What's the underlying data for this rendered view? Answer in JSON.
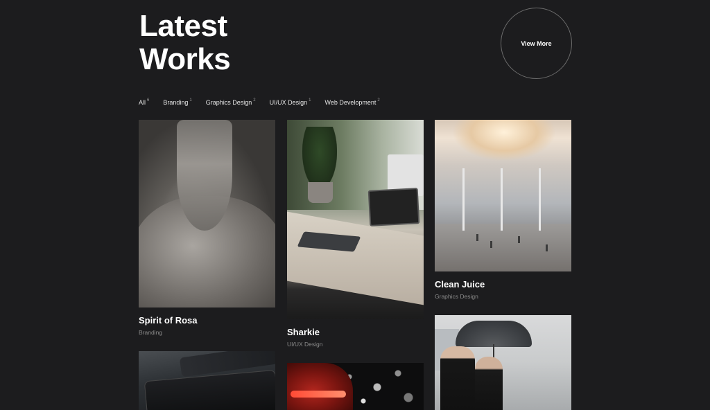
{
  "header": {
    "title_line1": "Latest",
    "title_line2": "Works",
    "view_more_label": "View More"
  },
  "filters": [
    {
      "label": "All",
      "count": "6"
    },
    {
      "label": "Branding",
      "count": "1"
    },
    {
      "label": "Graphics Design",
      "count": "2"
    },
    {
      "label": "UI/UX Design",
      "count": "1"
    },
    {
      "label": "Web Development",
      "count": "2"
    }
  ],
  "works": [
    {
      "title": "Spirit of Rosa",
      "category": "Branding"
    },
    {
      "title": "Sharkie",
      "category": "UI/UX Design"
    },
    {
      "title": "Clean Juice",
      "category": "Graphics Design"
    }
  ],
  "colors": {
    "background": "#1c1c1e",
    "text": "#ffffff",
    "muted": "#8b8b8b"
  }
}
